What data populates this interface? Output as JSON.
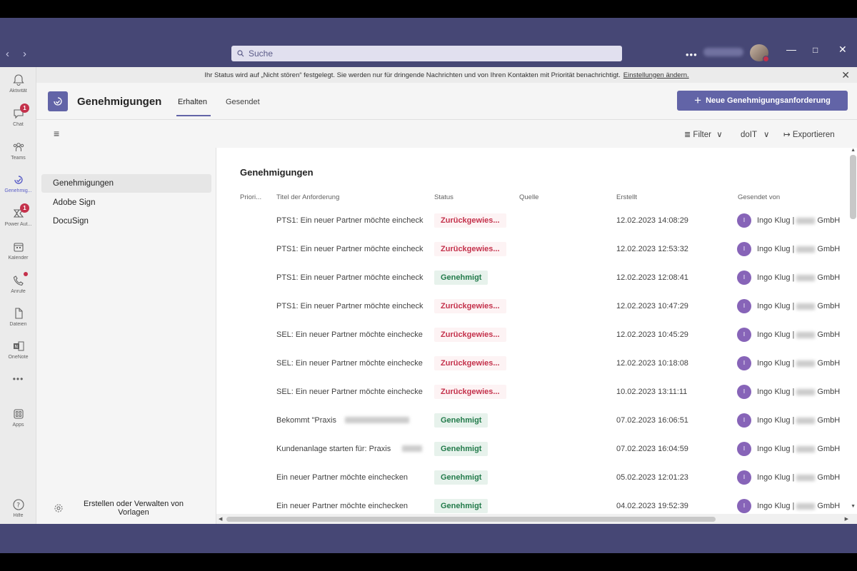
{
  "search": {
    "placeholder": "Suche"
  },
  "rail": [
    {
      "label": "Aktivität",
      "icon": "bell-icon"
    },
    {
      "label": "Chat",
      "icon": "chat-icon",
      "badge": "1"
    },
    {
      "label": "Teams",
      "icon": "teams-icon"
    },
    {
      "label": "Genehmig...",
      "icon": "approvals-icon",
      "active": true
    },
    {
      "label": "Power Aut...",
      "icon": "power-automate-icon",
      "badge": "1"
    },
    {
      "label": "Kalender",
      "icon": "calendar-icon"
    },
    {
      "label": "Anrufe",
      "icon": "phone-icon"
    },
    {
      "label": "Dateien",
      "icon": "file-icon"
    },
    {
      "label": "OneNote",
      "icon": "onenote-icon"
    },
    {
      "label": "",
      "icon": "more-icon"
    },
    {
      "label": "Apps",
      "icon": "apps-icon"
    },
    {
      "label": "Hilfe",
      "icon": "help-icon"
    }
  ],
  "banner": {
    "text": "Ihr Status wird auf „Nicht stören“ festgelegt. Sie werden nur für dringende Nachrichten und von Ihren Kontakten mit Priorität benachrichtigt.",
    "link": "Einstellungen ändern."
  },
  "header": {
    "title": "Genehmigungen",
    "tabs": [
      "Erhalten",
      "Gesendet"
    ],
    "new_button": "Neue Genehmigungsanforderung"
  },
  "toolbar": {
    "filter": "Filter",
    "org": "doIT",
    "export": "Exportieren"
  },
  "sidebar": {
    "items": [
      "Genehmigungen",
      "Adobe Sign",
      "DocuSign"
    ],
    "templates": "Erstellen oder Verwalten von Vorlagen"
  },
  "table": {
    "title": "Genehmigungen",
    "columns": [
      "Priori...",
      "Titel der Anforderung",
      "Status",
      "Quelle",
      "Erstellt",
      "Gesendet von"
    ],
    "rows": [
      {
        "title": "PTS1: Ein neuer Partner möchte eincheck",
        "status": "Zurückgewies...",
        "status_type": "rejected",
        "created": "12.02.2023 14:08:29",
        "sender": "Ingo Klug |",
        "company": "GmbH"
      },
      {
        "title": "PTS1: Ein neuer Partner möchte eincheck",
        "status": "Zurückgewies...",
        "status_type": "rejected",
        "created": "12.02.2023 12:53:32",
        "sender": "Ingo Klug |",
        "company": "GmbH"
      },
      {
        "title": "PTS1: Ein neuer Partner möchte eincheck",
        "status": "Genehmigt",
        "status_type": "approved",
        "created": "12.02.2023 12:08:41",
        "sender": "Ingo Klug |",
        "company": "GmbH"
      },
      {
        "title": "PTS1: Ein neuer Partner möchte eincheck",
        "status": "Zurückgewies...",
        "status_type": "rejected",
        "created": "12.02.2023 10:47:29",
        "sender": "Ingo Klug |",
        "company": "GmbH"
      },
      {
        "title": "SEL: Ein neuer Partner möchte einchecke",
        "status": "Zurückgewies...",
        "status_type": "rejected",
        "created": "12.02.2023 10:45:29",
        "sender": "Ingo Klug |",
        "company": "GmbH"
      },
      {
        "title": "SEL: Ein neuer Partner möchte einchecke",
        "status": "Zurückgewies...",
        "status_type": "rejected",
        "created": "12.02.2023 10:18:08",
        "sender": "Ingo Klug |",
        "company": "GmbH"
      },
      {
        "title": "SEL: Ein neuer Partner möchte einchecke",
        "status": "Zurückgewies...",
        "status_type": "rejected",
        "created": "10.02.2023 13:11:11",
        "sender": "Ingo Klug |",
        "company": "GmbH"
      },
      {
        "title": "Bekommt \"Praxis",
        "status": "Genehmigt",
        "status_type": "approved",
        "created": "07.02.2023 16:06:51",
        "sender": "Ingo Klug |",
        "company": "GmbH"
      },
      {
        "title": "Kundenanlage starten für: Praxis",
        "status": "Genehmigt",
        "status_type": "approved",
        "created": "07.02.2023 16:04:59",
        "sender": "Ingo Klug |",
        "company": "GmbH"
      },
      {
        "title": "Ein neuer Partner möchte einchecken",
        "status": "Genehmigt",
        "status_type": "approved",
        "created": "05.02.2023 12:01:23",
        "sender": "Ingo Klug |",
        "company": "GmbH"
      },
      {
        "title": "Ein neuer Partner möchte einchecken",
        "status": "Genehmigt",
        "status_type": "approved",
        "created": "04.02.2023 19:52:39",
        "sender": "Ingo Klug |",
        "company": "GmbH"
      }
    ]
  },
  "avatar_initial": "I",
  "colors": {
    "brand": "#6264a7",
    "titlebar": "#464775",
    "rejected": "#c4314b",
    "approved": "#237b4b",
    "avatar": "#8764b8"
  }
}
